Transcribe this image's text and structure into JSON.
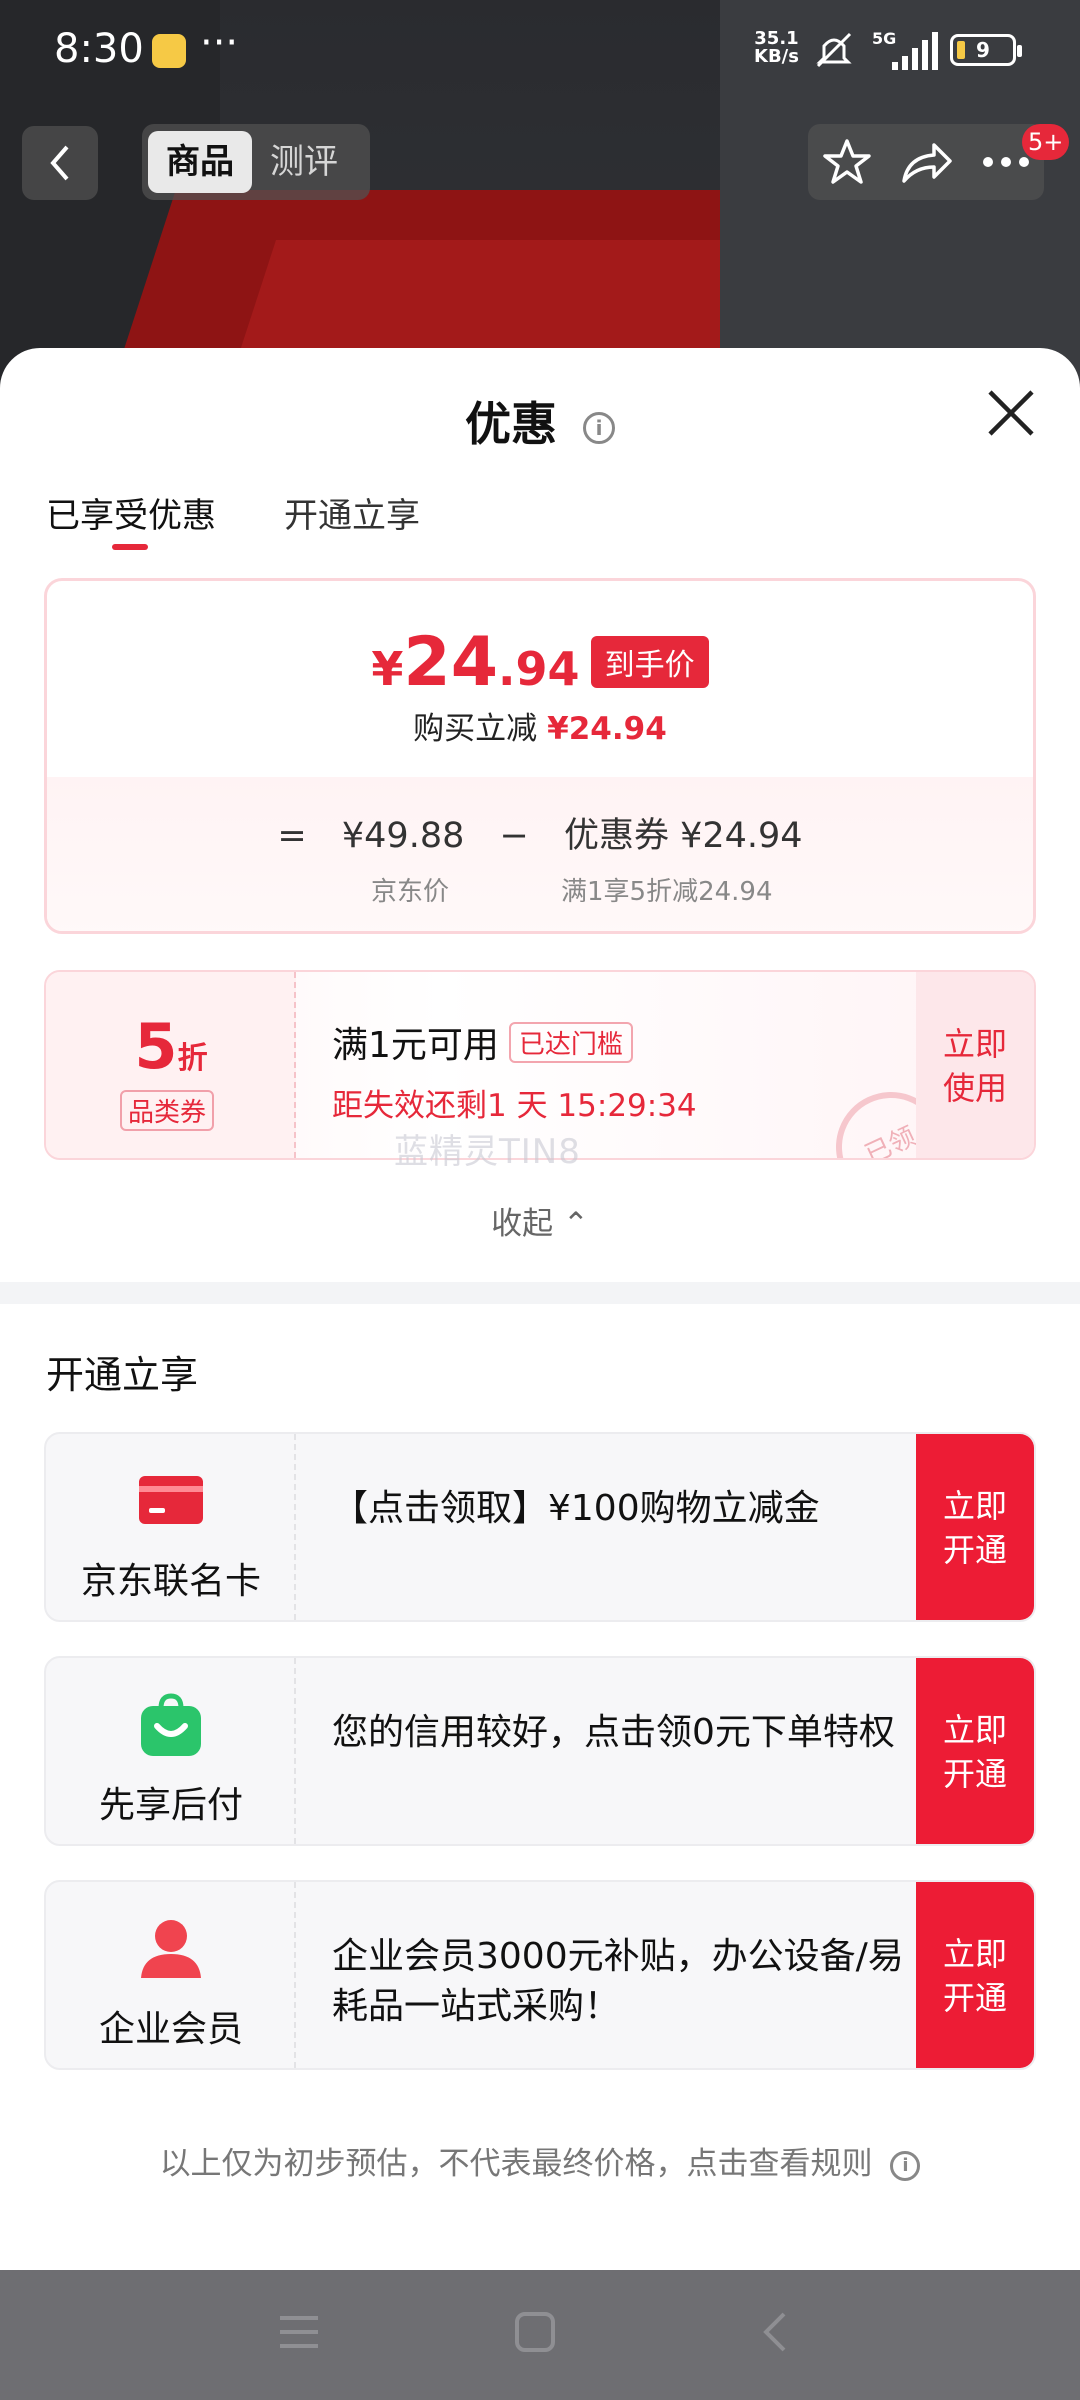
{
  "status_bar": {
    "time": "8:30",
    "more": "···",
    "net_speed_value": "35.1",
    "net_speed_unit": "KB/s",
    "network": "5G",
    "battery": "9"
  },
  "top_nav": {
    "tabs": [
      {
        "label": "商品"
      },
      {
        "label": "测评"
      }
    ],
    "badge": "5+"
  },
  "sheet": {
    "title": "优惠",
    "info_icon_glyph": "i",
    "tabs": [
      {
        "label": "已享受优惠"
      },
      {
        "label": "开通立享"
      }
    ],
    "price": {
      "currency": "¥",
      "integer": "24",
      "decimal": ".94",
      "tag": "到手价",
      "save_label": "购买立减",
      "save_value": "¥24.94",
      "equals": "=",
      "jd_price": "¥49.88",
      "minus": "−",
      "coupon_label": "优惠券 ¥24.94",
      "jd_price_caption": "京东价",
      "coupon_caption": "满1享5折减24.94"
    },
    "coupon": {
      "discount": "5",
      "discount_unit": "折",
      "category": "品类券",
      "condition": "满1元可用",
      "status_tag": "已达门槛",
      "expiry": "距失效还剩1 天 15:29:34",
      "action": "立即使用",
      "stamp": "已领"
    },
    "watermark": "蓝精灵TIN8",
    "collapse_label": "收起 ⌃",
    "section_title": "开通立享",
    "offers": [
      {
        "label": "京东联名卡",
        "icon": "credit-card-icon",
        "text": "【点击领取】¥100购物立减金",
        "action": "立即开通",
        "icon_color": "#e6283a"
      },
      {
        "label": "先享后付",
        "icon": "shopping-bag-icon",
        "text": "您的信用较好，点击领0元下单特权",
        "action": "立即开通",
        "icon_color": "#2bc56b"
      },
      {
        "label": "企业会员",
        "icon": "user-icon",
        "text": "企业会员3000元补贴，办公设备/易耗品一站式采购！",
        "action": "立即开通",
        "icon_color": "#f0444f"
      }
    ],
    "footer_note": "以上仅为初步预估，不代表最终价格，点击查看规则"
  },
  "colors": {
    "accent": "#e6283a",
    "button": "#ed1c35"
  }
}
